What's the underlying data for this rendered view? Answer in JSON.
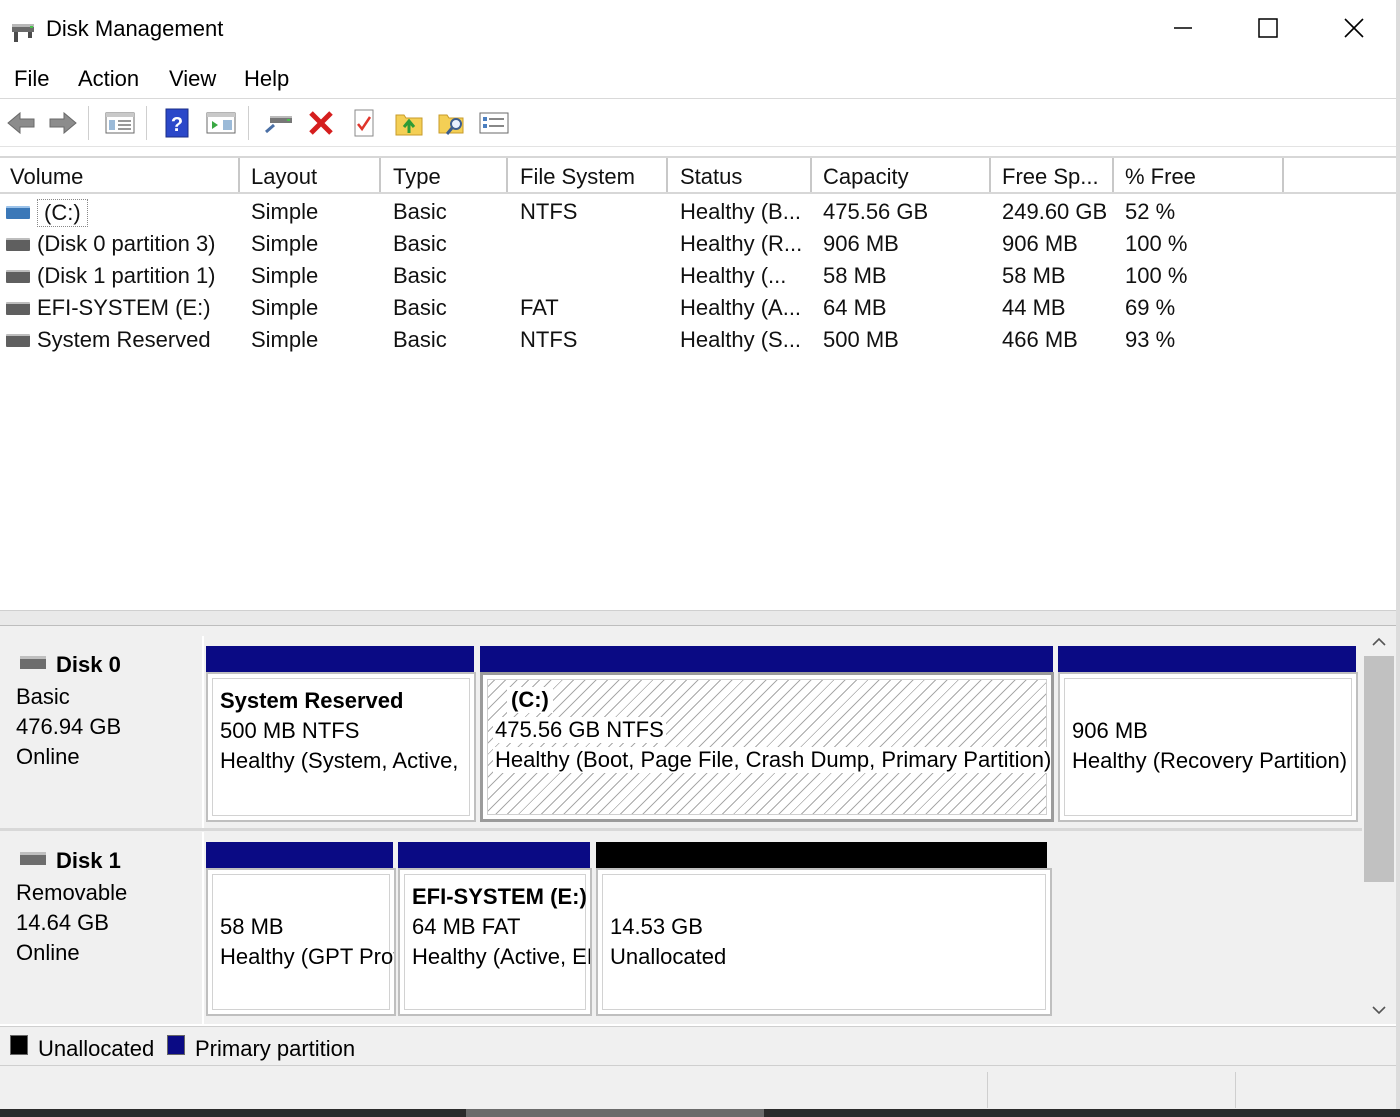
{
  "window": {
    "title": "Disk Management"
  },
  "menu": [
    "File",
    "Action",
    "View",
    "Help"
  ],
  "toolbar": {
    "buttons": [
      "back-icon",
      "forward-icon",
      "show-hide-tree-icon",
      "help-icon",
      "show-hide-action-pane-icon",
      "connect-disk-icon",
      "delete-icon",
      "properties-icon",
      "open-folder-icon",
      "explore-icon",
      "settings-list-icon"
    ]
  },
  "table": {
    "columns": [
      "Volume",
      "Layout",
      "Type",
      "File System",
      "Status",
      "Capacity",
      "Free Sp...",
      "% Free"
    ],
    "rows": [
      {
        "volume": "(C:)",
        "layout": "Simple",
        "type": "Basic",
        "fs": "NTFS",
        "status": "Healthy (B...",
        "capacity": "475.56 GB",
        "free": "249.60 GB",
        "pct": "52 %",
        "icon_color": "#3b78b8",
        "selected": true
      },
      {
        "volume": "(Disk 0 partition 3)",
        "layout": "Simple",
        "type": "Basic",
        "fs": "",
        "status": "Healthy (R...",
        "capacity": "906 MB",
        "free": "906 MB",
        "pct": "100 %",
        "icon_color": "#5f5f5f"
      },
      {
        "volume": "(Disk 1 partition 1)",
        "layout": "Simple",
        "type": "Basic",
        "fs": "",
        "status": "Healthy (...",
        "capacity": "58 MB",
        "free": "58 MB",
        "pct": "100 %",
        "icon_color": "#5f5f5f"
      },
      {
        "volume": "EFI-SYSTEM (E:)",
        "layout": "Simple",
        "type": "Basic",
        "fs": "FAT",
        "status": "Healthy (A...",
        "capacity": "64 MB",
        "free": "44 MB",
        "pct": "69 %",
        "icon_color": "#5f5f5f"
      },
      {
        "volume": "System Reserved",
        "layout": "Simple",
        "type": "Basic",
        "fs": "NTFS",
        "status": "Healthy (S...",
        "capacity": "500 MB",
        "free": "466 MB",
        "pct": "93 %",
        "icon_color": "#5f5f5f"
      }
    ]
  },
  "disks": [
    {
      "name": "Disk 0",
      "kind": "Basic",
      "size": "476.94 GB",
      "state": "Online",
      "partitions": [
        {
          "title": "System Reserved",
          "line1": "500 MB NTFS",
          "line2": "Healthy (System, Active,",
          "kind": "primary"
        },
        {
          "title": "(C:)",
          "line1": "475.56 GB NTFS",
          "line2": "Healthy (Boot, Page File, Crash Dump, Primary Partition)",
          "kind": "primary",
          "selected": true
        },
        {
          "title": "",
          "line1": "906 MB",
          "line2": "Healthy (Recovery Partition)",
          "kind": "primary"
        }
      ]
    },
    {
      "name": "Disk 1",
      "kind": "Removable",
      "size": "14.64 GB",
      "state": "Online",
      "partitions": [
        {
          "title": "",
          "line1": "58 MB",
          "line2": "Healthy (GPT Protective Partition)",
          "kind": "primary"
        },
        {
          "title": "EFI-SYSTEM  (E:)",
          "line1": "64 MB FAT",
          "line2": "Healthy (Active, EFI System Partition)",
          "kind": "primary"
        },
        {
          "title": "",
          "line1": "14.53 GB",
          "line2": "Unallocated",
          "kind": "unallocated"
        }
      ]
    }
  ],
  "legend": [
    {
      "label": "Unallocated",
      "color": "#000000"
    },
    {
      "label": "Primary partition",
      "color": "#00007f"
    }
  ],
  "colors": {
    "primary": "#0a0a84",
    "unallocated": "#000000"
  }
}
